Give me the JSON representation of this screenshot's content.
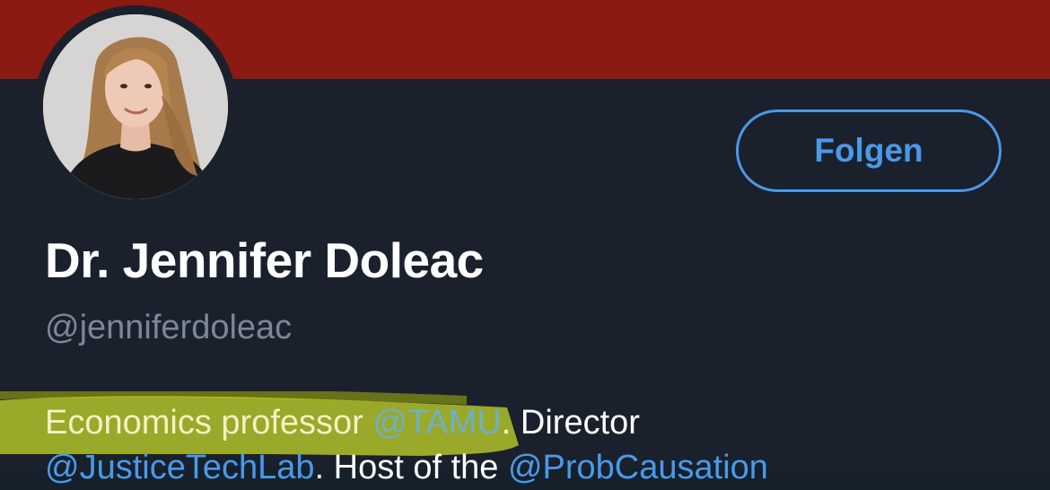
{
  "profile": {
    "display_name": "Dr. Jennifer Doleac",
    "handle": "@jenniferdoleac",
    "follow_label": "Folgen",
    "bio": {
      "line1_text1": "Economics professor ",
      "line1_mention1": "@TAMU",
      "line1_text2": ". Director",
      "line2_mention1": "@JusticeTechLab",
      "line2_text1": ". Host of the ",
      "line2_mention2": "@ProbCausation"
    }
  },
  "colors": {
    "banner": "#8a1a12",
    "background": "#1a212c",
    "accent": "#4a99e9",
    "secondary_text": "#7b8894",
    "highlighter": "#c8d400"
  },
  "icons": {
    "avatar": "profile-photo"
  }
}
